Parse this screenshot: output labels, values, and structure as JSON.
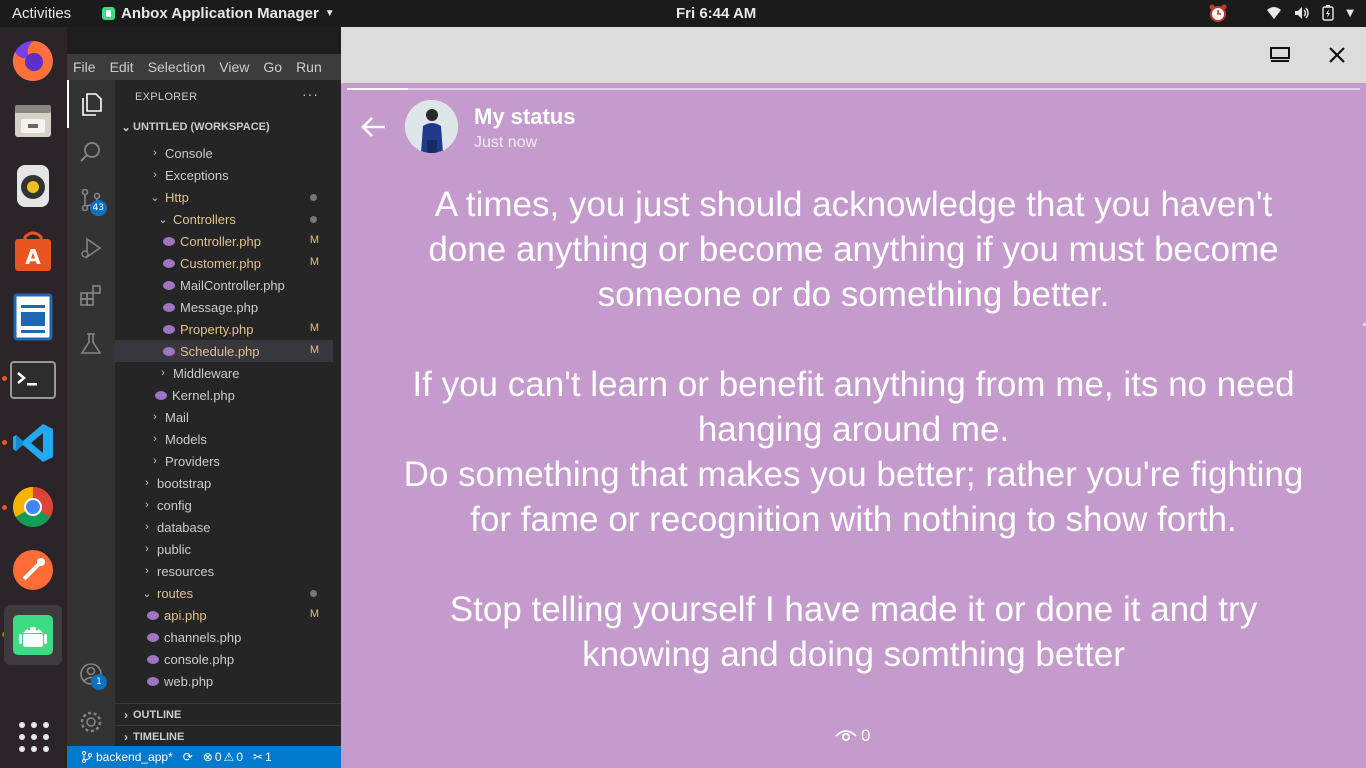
{
  "topbar": {
    "activities": "Activities",
    "app_menu": "Anbox Application Manager",
    "clock": "Fri  6:44 AM"
  },
  "dock": {
    "items": [
      {
        "name": "firefox"
      },
      {
        "name": "files"
      },
      {
        "name": "rhythmbox"
      },
      {
        "name": "software-center"
      },
      {
        "name": "libreoffice-writer"
      },
      {
        "name": "terminal"
      },
      {
        "name": "vscode"
      },
      {
        "name": "chrome"
      },
      {
        "name": "postman"
      },
      {
        "name": "anbox"
      }
    ]
  },
  "vscode": {
    "menu": [
      "File",
      "Edit",
      "Selection",
      "View",
      "Go",
      "Run"
    ],
    "source_control_badge": "43",
    "accounts_badge": "1",
    "explorer_title": "EXPLORER",
    "more": "···",
    "workspace": "UNTITLED (WORKSPACE)",
    "tree": [
      {
        "label": "Console",
        "chev": "›"
      },
      {
        "label": "Exceptions",
        "chev": "›"
      },
      {
        "label": "Http",
        "chev": "⌄",
        "mod": true,
        "dot": true
      },
      {
        "label": "Controllers",
        "chev": "⌄",
        "mod": true,
        "dot": true
      },
      {
        "label": "Controller.php",
        "php": true,
        "mod": true,
        "status": "M"
      },
      {
        "label": "Customer.php",
        "php": true,
        "mod": true,
        "status": "M"
      },
      {
        "label": "MailController.php",
        "php": true
      },
      {
        "label": "Message.php",
        "php": true
      },
      {
        "label": "Property.php",
        "php": true,
        "mod": true,
        "status": "M"
      },
      {
        "label": "Schedule.php",
        "php": true,
        "mod": true,
        "status": "M",
        "selected": true
      },
      {
        "label": "Middleware",
        "chev": "›"
      },
      {
        "label": "Kernel.php",
        "php": true
      },
      {
        "label": "Mail",
        "chev": "›"
      },
      {
        "label": "Models",
        "chev": "›"
      },
      {
        "label": "Providers",
        "chev": "›"
      },
      {
        "label": "bootstrap",
        "chev": "›"
      },
      {
        "label": "config",
        "chev": "›"
      },
      {
        "label": "database",
        "chev": "›"
      },
      {
        "label": "public",
        "chev": "›"
      },
      {
        "label": "resources",
        "chev": "›"
      },
      {
        "label": "routes",
        "chev": "⌄",
        "mod": true,
        "dot": true
      },
      {
        "label": "api.php",
        "php": true,
        "mod": true,
        "status": "M"
      },
      {
        "label": "channels.php",
        "php": true
      },
      {
        "label": "console.php",
        "php": true
      },
      {
        "label": "web.php",
        "php": true
      }
    ],
    "outline": "OUTLINE",
    "timeline": "TIMELINE",
    "statusbar": {
      "branch": "backend_app*",
      "errors": "0",
      "warnings": "0",
      "ports": "1"
    }
  },
  "status_viewer": {
    "title": "My status",
    "time": "Just now",
    "progress_fraction": 0.06,
    "text": "A times, you just should acknowledge that you haven't\ndone anything or become anything if you must become\nsomeone or do something better.\n\nIf you can't learn or benefit anything from me, its no need\nhanging around me.\nDo something that makes you better; rather you're fighting\nfor fame or recognition with nothing to show forth.\n\nStop telling yourself I have made it or done it and try\nknowing and doing somthing better",
    "views": "0",
    "background_color": "#c49bcc"
  }
}
